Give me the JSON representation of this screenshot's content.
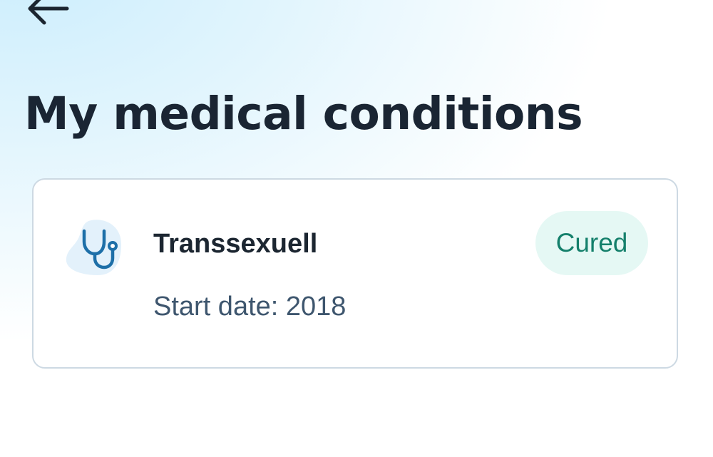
{
  "header": {
    "back_icon": "arrow-left-icon",
    "title": "My medical conditions"
  },
  "conditions": [
    {
      "icon": "stethoscope-icon",
      "name": "Transsexuell",
      "status": "Cured",
      "start_date": "Start date: 2018"
    }
  ],
  "colors": {
    "title_text": "#1a2533",
    "card_border": "#cdd9e3",
    "icon_blob": "#e3f1fb",
    "icon_stroke": "#1d6fa8",
    "badge_background": "#e5f8f4",
    "badge_text": "#14806b",
    "secondary_text": "#3e566e",
    "background_tint": "#cdeefd"
  }
}
